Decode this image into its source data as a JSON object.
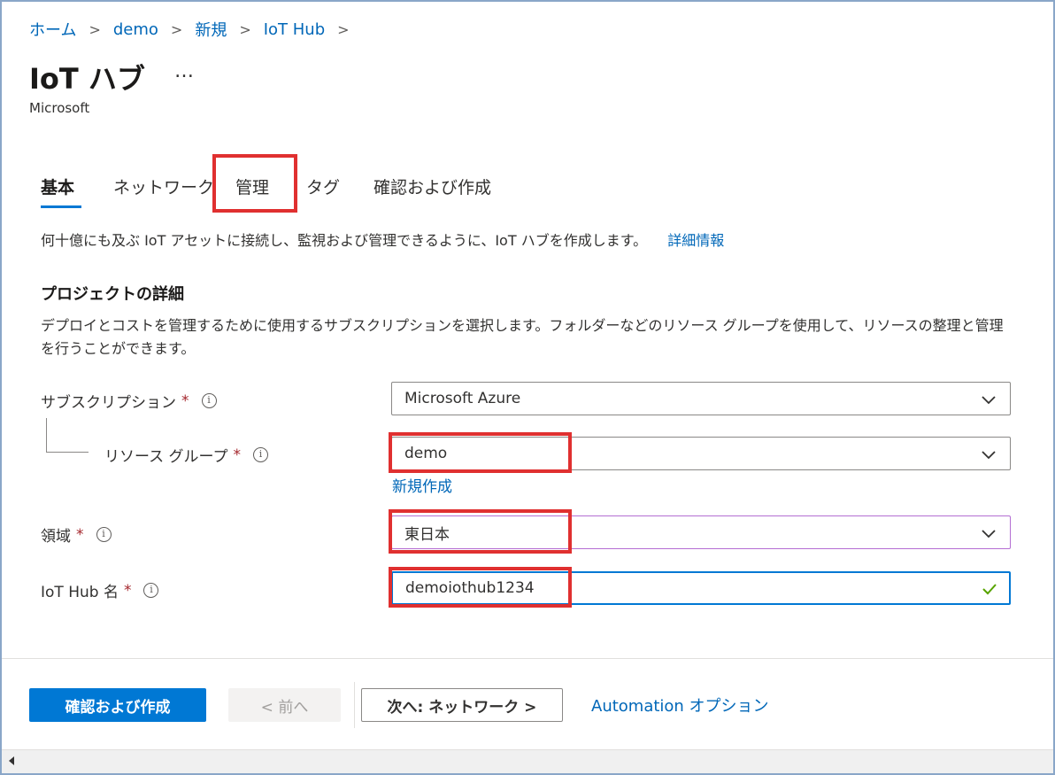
{
  "breadcrumb": [
    "ホーム",
    "demo",
    "新規",
    "IoT Hub"
  ],
  "header": {
    "title": "IoT ハブ",
    "more": "…",
    "subtitle": "Microsoft"
  },
  "tabs": [
    {
      "label": "基本",
      "active": true
    },
    {
      "label": "ネットワーク",
      "active": false
    },
    {
      "label": "管理",
      "active": false
    },
    {
      "label": "タグ",
      "active": false
    },
    {
      "label": "確認および作成",
      "active": false
    }
  ],
  "intro": {
    "text": "何十億にも及ぶ IoT アセットに接続し、監視および管理できるように、IoT ハブを作成します。",
    "link": "詳細情報"
  },
  "project": {
    "title": "プロジェクトの詳細",
    "description": "デプロイとコストを管理するために使用するサブスクリプションを選択します。フォルダーなどのリソース グループを使用して、リソースの整理と管理を行うことができます。"
  },
  "form": {
    "subscription": {
      "label": "サブスクリプション",
      "value": "Microsoft Azure"
    },
    "resource_group": {
      "label": "リソース グループ",
      "value": "demo",
      "create_new": "新規作成"
    },
    "region": {
      "label": "領域",
      "value": "東日本"
    },
    "hub_name": {
      "label": "IoT Hub 名",
      "value": "demoiothub1234"
    },
    "required_mark": "*",
    "info_glyph": "i"
  },
  "footer": {
    "review_create": "確認および作成",
    "previous": "< 前へ",
    "next": "次へ: ネットワーク >",
    "automation": "Automation オプション"
  },
  "colors": {
    "accent": "#0078d4",
    "link": "#0067b8",
    "required": "#a4262c",
    "highlight": "#e03030",
    "valid": "#57a300"
  }
}
